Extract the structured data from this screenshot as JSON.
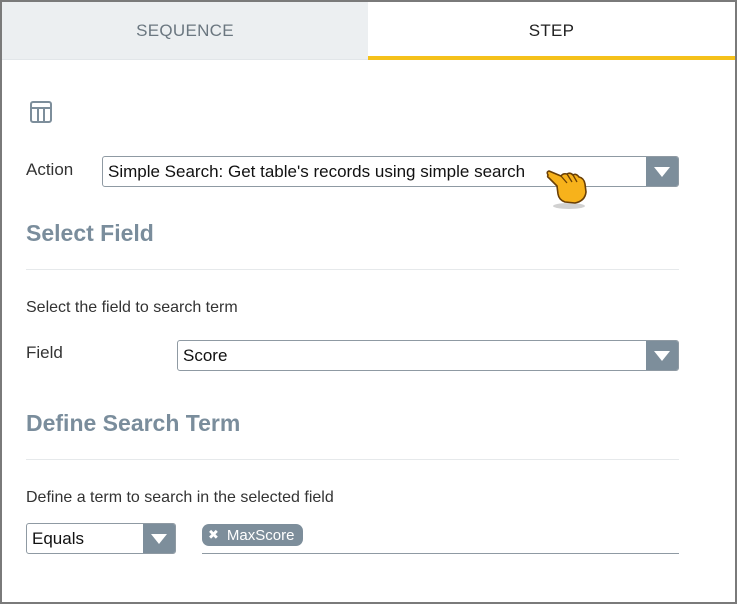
{
  "tabs": [
    {
      "label": "SEQUENCE",
      "active": false
    },
    {
      "label": "STEP",
      "active": true
    }
  ],
  "toolbar": {
    "icon": "table-icon"
  },
  "action": {
    "label": "Action",
    "value": "Simple Search: Get table's records using simple search"
  },
  "select_field": {
    "title": "Select Field",
    "description": "Select the field to search term",
    "field_label": "Field",
    "field_value": "Score"
  },
  "search_term": {
    "title": "Define Search Term",
    "description": "Define a term to search in the selected field",
    "operator": "Equals",
    "chip_label": "MaxScore"
  },
  "colors": {
    "accent": "#f5c11a",
    "section_title": "#7a8d9c",
    "arrow_bg": "#7d8e9b"
  }
}
